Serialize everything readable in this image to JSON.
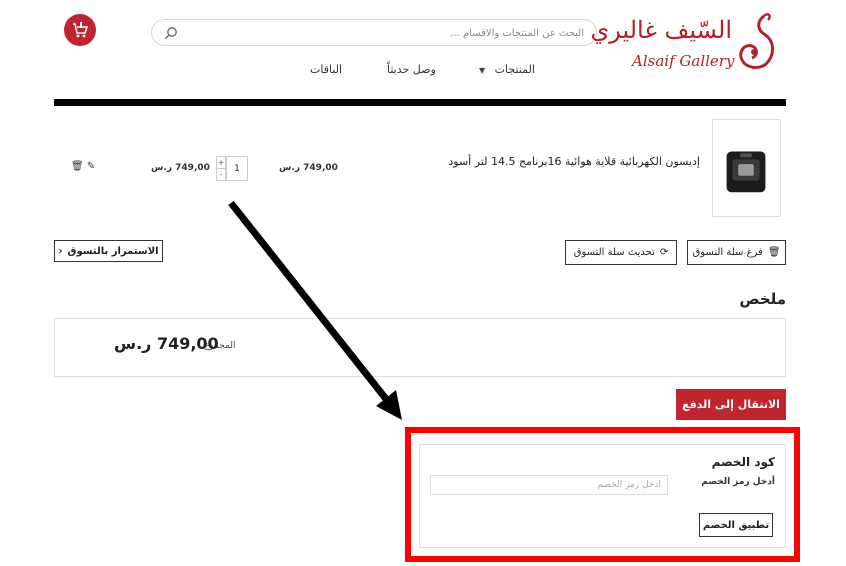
{
  "header": {
    "search": {
      "placeholder": "البحث عن المنتجات والاقسام ..."
    },
    "logo": {
      "arabic": "السّيف غاليري",
      "english": "Alsaif Gallery"
    },
    "cart_icon": "cart-icon",
    "nav": [
      {
        "label": "المنتجات",
        "has_dropdown": true
      },
      {
        "label": "وصل حديثاً"
      },
      {
        "label": "الباقات"
      }
    ]
  },
  "cart": {
    "items": [
      {
        "name": "إديسون الكهربائية قلاية هوائية 16برنامج 14.5 لتر أسود",
        "unit_price": "749,00 ر.س",
        "quantity": "1",
        "qty_plus": "+",
        "qty_minus": "-",
        "line_total": "749,00 ر.س",
        "icons": [
          "edit-icon",
          "trash-icon"
        ]
      }
    ],
    "buttons": {
      "empty": "فرغ سلة التسوق",
      "update": "تحديث سلة التسوق",
      "continue": "الاستمرار بالتسوق"
    }
  },
  "summary": {
    "title": "ملخص",
    "total_label": "المجموع",
    "total_value": "749,00 ر.س"
  },
  "checkout": {
    "label": "الانتقال إلى الدفع"
  },
  "coupon": {
    "title": "كود الخصم",
    "label": "أدخل رمز الخصم",
    "placeholder": "أدخل رمز الخصم",
    "apply": "تطبيق الخصم"
  },
  "colors": {
    "brand_red": "#c0242f",
    "highlight_red": "#ff0000",
    "divider": "#000000"
  }
}
